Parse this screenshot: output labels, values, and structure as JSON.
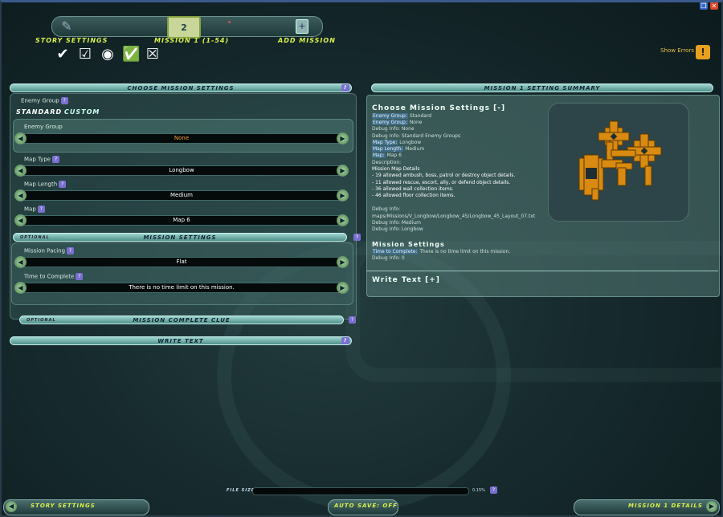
{
  "window": {
    "buttons": [
      "restore-icon",
      "close-icon"
    ]
  },
  "topnav": {
    "story_settings": "STORY SETTINGS",
    "mission": "MISSION 1 (1-54)",
    "mission_book_number": "2",
    "add_mission": "ADD MISSION"
  },
  "checks": [
    "checkmark-icon",
    "checkbox-icon",
    "target-icon",
    "edit-check-icon",
    "x-box-icon"
  ],
  "show_errors": "Show Errors",
  "left": {
    "header": "CHOOSE MISSION SETTINGS",
    "enemy_group_label": "Enemy Group",
    "tab_standard": "STANDARD",
    "tab_custom": "CUSTOM",
    "enemy_group_sub": "Enemy Group",
    "enemy_group_value": "None",
    "map_type_label": "Map Type",
    "map_type_value": "Longbow",
    "map_length_label": "Map Length",
    "map_length_value": "Medium",
    "map_label": "Map",
    "map_value": "Map 6",
    "optional": "OPTIONAL",
    "mission_settings": "MISSION SETTINGS",
    "pacing_label": "Mission Pacing",
    "pacing_value": "Flat",
    "time_label": "Time to Complete",
    "time_value": "There is no time limit on this mission.",
    "optional2": "OPTIONAL",
    "complete_clue": "MISSION COMPLETE CLUE",
    "write_text": "WRITE TEXT"
  },
  "summary": {
    "header": "MISSION 1 SETTING SUMMARY",
    "title": "Choose Mission Settings [-]",
    "enemy_group_k": "Enemy Group:",
    "enemy_group_v": "Standard",
    "enemy_group2_k": "Enemy Group:",
    "enemy_group2_v": "None",
    "debug1": "Debug Info: None",
    "debug2": "Debug Info: Standard Enemy Groups",
    "map_type_k": "Map Type:",
    "map_type_v": "Longbow",
    "map_length_k": "Map Length:",
    "map_length_v": "Medium",
    "map_k": "Map:",
    "map_v": "Map 6",
    "description": "Description:",
    "details_title": "Mission Map Details",
    "d1": "- 19 allowed ambush, boss, patrol or destroy object details.",
    "d2": "- 11 allowed rescue, escort, ally, or defend object details.",
    "d3": "- 36 allowed wall collection items.",
    "d4": "- 46 allowed floor collection items.",
    "debug3": "Debug Info:",
    "debug4": "maps/Missions/V_Longbow/Longbow_45/Longbow_45_Layout_07.txt",
    "debug5": "Debug Info: Medium",
    "debug6": "Debug Info: Longbow",
    "ms_title": "Mission Settings",
    "time_k": "Time to Complete:",
    "time_v": "There is no time limit on this mission.",
    "debug7": "Debug Info: 0",
    "write_text": "Write Text [+]"
  },
  "footer": {
    "file_size": "FILE SIZE:",
    "percent": "0.15%",
    "story_settings": "STORY SETTINGS",
    "auto_save": "AUTO SAVE: OFF",
    "mission_details": "MISSION 1 DETAILS"
  }
}
